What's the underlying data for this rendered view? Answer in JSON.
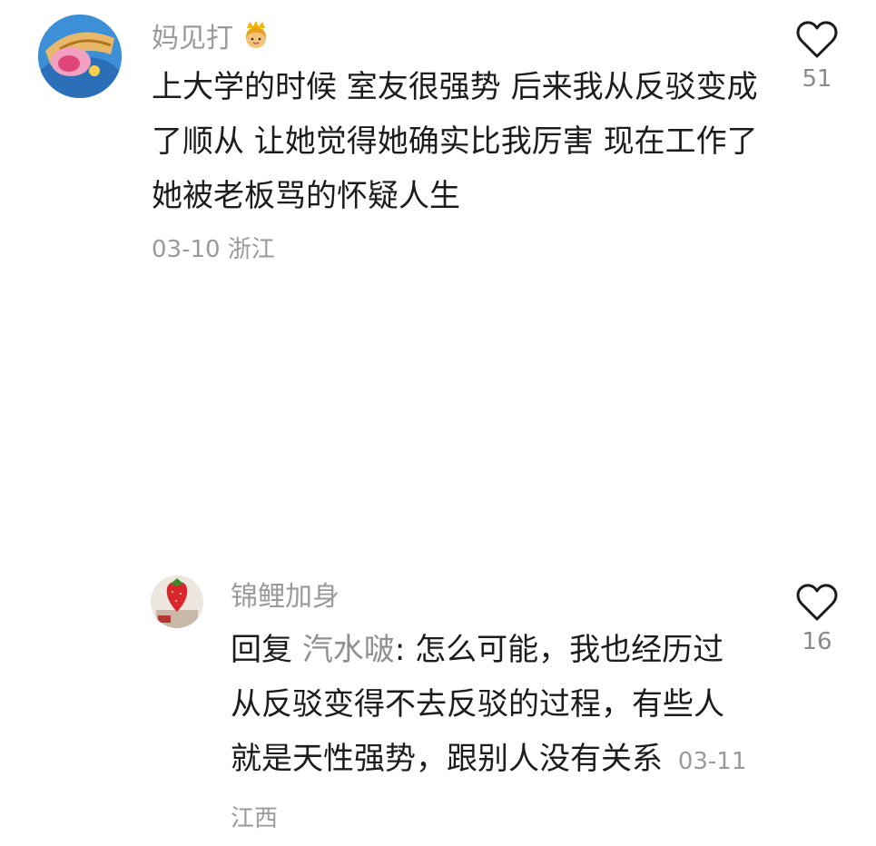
{
  "comments": [
    {
      "username": "妈见打",
      "badge_icon": "princess-icon",
      "text": "上大学的时候 室友很强势 后来我从反驳变成了顺从 让她觉得她确实比我厉害 现在工作了 她被老板骂的怀疑人生",
      "date": "03-10",
      "location": "浙江",
      "likes": "51",
      "like_icon": "heart-outline-icon"
    },
    {
      "username": "锦鲤加身",
      "reply_prefix": "回复",
      "reply_to": "汽水啵",
      "text": ": 怎么可能，我也经历过从反驳变得不去反驳的过程，有些人就是天性强势，跟别人没有关系",
      "date": "03-11",
      "location": "江西",
      "likes": "16",
      "like_icon": "heart-outline-icon"
    }
  ],
  "colors": {
    "text_primary": "#1c1c1c",
    "text_secondary": "#9a9a9a",
    "background": "#ffffff"
  }
}
